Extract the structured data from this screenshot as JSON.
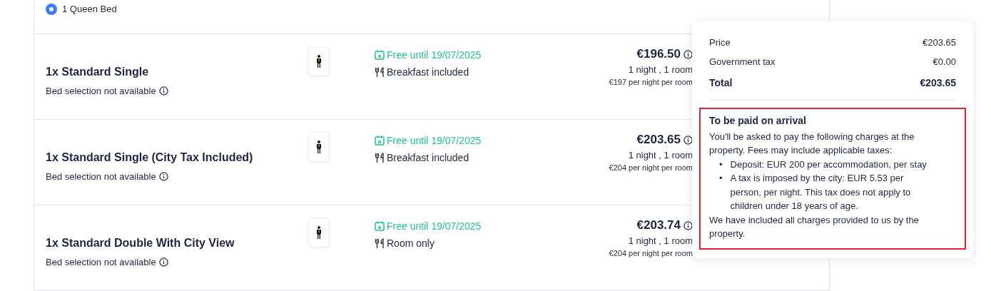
{
  "bed_option": {
    "label": "1 Queen Bed",
    "selected": true
  },
  "rooms": [
    {
      "title": "1x Standard Single",
      "bed_note": "Bed selection not available",
      "cancellation": "Free until 19/07/2025",
      "meal": "Breakfast included",
      "price": "€196.50",
      "stay": "1 night , 1 room",
      "per_night": "€197 per night per room"
    },
    {
      "title": "1x Standard Single (City Tax Included)",
      "bed_note": "Bed selection not available",
      "cancellation": "Free until 19/07/2025",
      "meal": "Breakfast included",
      "price": "€203.65",
      "stay": "1 night , 1 room",
      "per_night": "€204 per night per room"
    },
    {
      "title": "1x Standard Double With City View",
      "bed_note": "Bed selection not available",
      "cancellation": "Free until 19/07/2025",
      "meal": "Room only",
      "price": "€203.74",
      "stay": "1 night , 1 room",
      "per_night": "€204 per night per room"
    }
  ],
  "price_popover": {
    "lines": [
      {
        "label": "Price",
        "value": "€203.65",
        "kind": "normal"
      },
      {
        "label": "Government tax",
        "value": "€0.00",
        "kind": "normal"
      },
      {
        "label": "Total",
        "value": "€203.65",
        "kind": "total"
      }
    ],
    "arrival": {
      "title": "To be paid on arrival",
      "intro": "You'll be asked to pay the following charges at the property. Fees may include applicable taxes:",
      "items": [
        {
          "bullet": "•",
          "text": "Deposit: EUR 200 per accommodation, per stay"
        },
        {
          "bullet": "•",
          "text": "A tax is imposed by the city: EUR 5.53 per person, per night. This tax does not apply to children under 18 years of age."
        }
      ],
      "outro": "We have included all charges provided to us by the property."
    }
  }
}
